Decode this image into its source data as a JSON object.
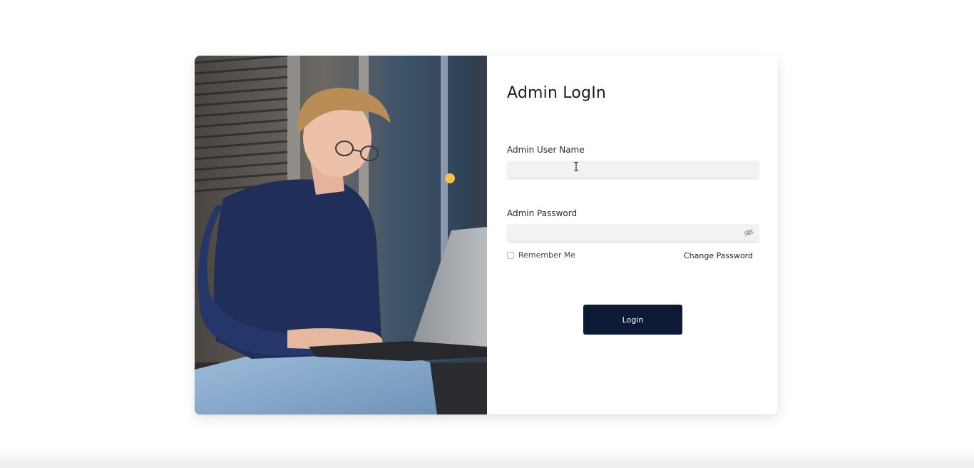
{
  "form": {
    "title": "Admin LogIn",
    "username_label": "Admin User Name",
    "username_value": "",
    "username_placeholder": "",
    "password_label": "Admin Password",
    "password_value": "",
    "password_placeholder": "",
    "remember_label": "Remember Me",
    "remember_checked": false,
    "change_password_label": "Change Password",
    "login_label": "Login"
  },
  "icons": {
    "password_toggle": "eye-off-icon",
    "text_cursor": "text-cursor-icon"
  },
  "colors": {
    "primary_button": "#0d1a36",
    "input_background": "#f2f2f2",
    "page_background": "#ffffff"
  }
}
